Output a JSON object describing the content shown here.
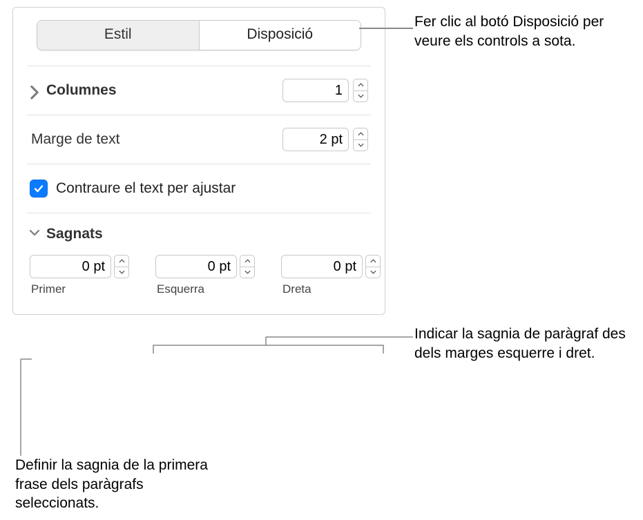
{
  "tabs": {
    "style": "Estil",
    "layout": "Disposició"
  },
  "columns": {
    "label": "Columnes",
    "value": "1"
  },
  "text_inset": {
    "label": "Marge de text",
    "value": "2 pt"
  },
  "shrink": {
    "label": "Contraure el text per ajustar"
  },
  "sagnats": {
    "label": "Sagnats",
    "primer": {
      "label": "Primer",
      "value": "0 pt"
    },
    "esquerra": {
      "label": "Esquerra",
      "value": "0 pt"
    },
    "dreta": {
      "label": "Dreta",
      "value": "0 pt"
    }
  },
  "callouts": {
    "layout_tab": "Fer clic al botó Disposició per veure els controls a sota.",
    "margins": "Indicar la sagnia de paràgraf des dels marges esquerre i dret.",
    "first": "Definir la sagnia de la primera frase dels paràgrafs seleccionats."
  }
}
